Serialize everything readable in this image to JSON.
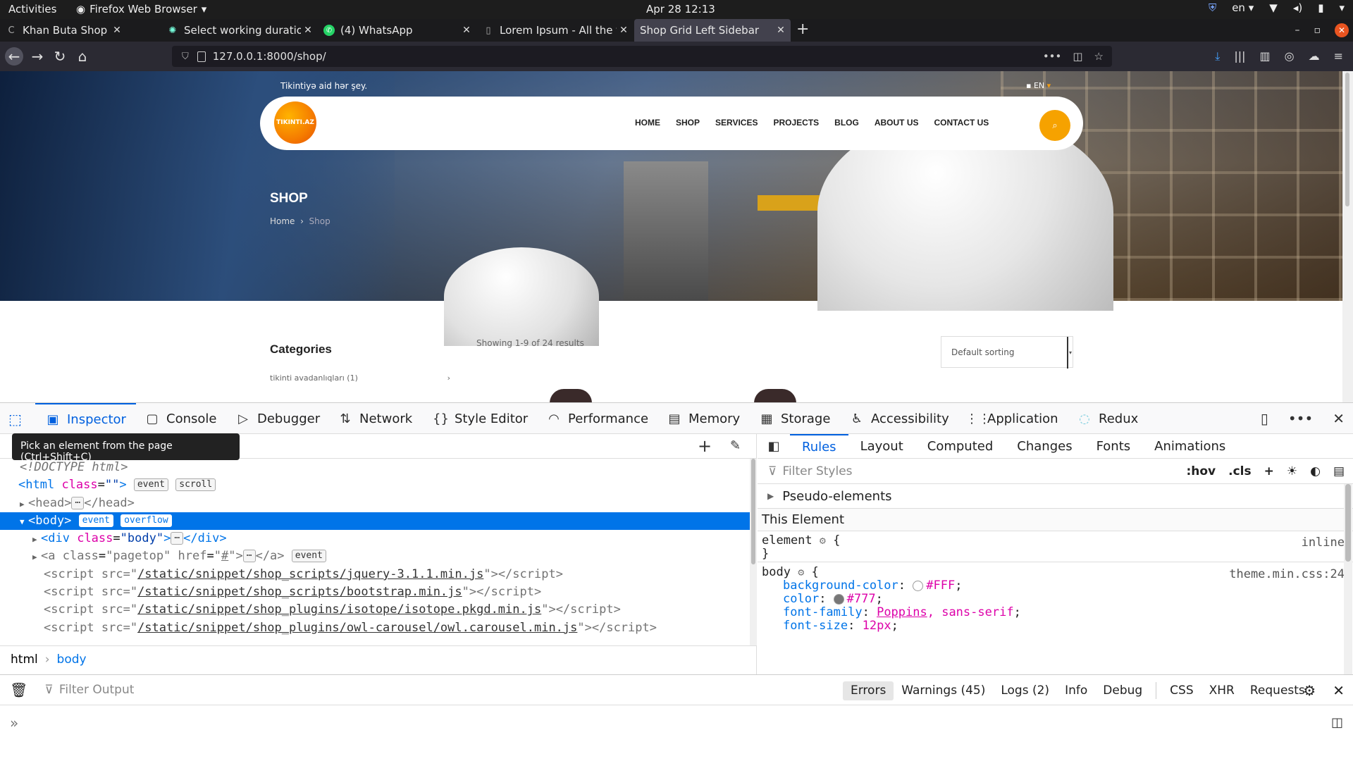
{
  "system_bar": {
    "activities": "Activities",
    "app_name": "Firefox Web Browser",
    "clock": "Apr 28  12:13",
    "lang": "en"
  },
  "tabs": [
    {
      "title": "Khan Buta Shop",
      "icon": "khan-buta-icon"
    },
    {
      "title": "Select working duration",
      "icon": "gear-icon"
    },
    {
      "title": "(4) WhatsApp",
      "icon": "whatsapp-icon"
    },
    {
      "title": "Lorem Ipsum - All the fac",
      "icon": "lorem-icon"
    },
    {
      "title": "Shop Grid Left Sidebar",
      "icon": "none",
      "active": true
    }
  ],
  "urlbar": {
    "url": "127.0.0.1:8000/shop/"
  },
  "site": {
    "tagline": "Tikintiyə aid hər şey.",
    "lang": "EN",
    "logo_text": "TIKINTI.AZ",
    "menu": [
      "HOME",
      "SHOP",
      "SERVICES",
      "PROJECTS",
      "BLOG",
      "ABOUT US",
      "CONTACT US"
    ],
    "page_title": "SHOP",
    "breadcrumb": {
      "home": "Home",
      "current": "Shop"
    },
    "categories_title": "Categories",
    "category_item": "tikinti avadanlıqları (1)",
    "results": "Showing 1-9 of 24 results",
    "sorting": "Default sorting"
  },
  "devtools": {
    "tooltip": "Pick an element from the page (Ctrl+Shift+C)",
    "tabs": [
      "Inspector",
      "Console",
      "Debugger",
      "Network",
      "Style Editor",
      "Performance",
      "Memory",
      "Storage",
      "Accessibility",
      "Application",
      "Redux"
    ],
    "markup": {
      "doctype": "<!DOCTYPE html>",
      "event": "event",
      "scroll": "scroll",
      "overflow": "overflow",
      "scripts": [
        "/static/snippet/shop_scripts/jquery-3.1.1.min.js",
        "/static/snippet/shop_scripts/bootstrap.min.js",
        "/static/snippet/shop_plugins/isotope/isotope.pkgd.min.js",
        "/static/snippet/shop_plugins/owl-carousel/owl.carousel.min.js"
      ]
    },
    "breadcrumbs": [
      "html",
      "body"
    ],
    "rules_tabs": [
      "Rules",
      "Layout",
      "Computed",
      "Changes",
      "Fonts",
      "Animations"
    ],
    "filter_styles": "Filter Styles",
    "hov": ":hov",
    "cls": ".cls",
    "pseudo_elements": "Pseudo-elements",
    "this_element": "This Element",
    "element_rule": {
      "selector": "element",
      "source": "inline"
    },
    "body_rule": {
      "selector": "body",
      "source": "theme.min.css:24",
      "decls": [
        {
          "prop": "background-color",
          "value": "#FFF",
          "swatch": "#FFFFFF"
        },
        {
          "prop": "color",
          "value": "#777",
          "swatch": "#777777"
        },
        {
          "prop": "font-family",
          "value": "Poppins",
          "value2": ", sans-serif"
        },
        {
          "prop": "font-size",
          "value": "12px"
        }
      ]
    },
    "console": {
      "filter": "Filter Output",
      "levels": [
        "Errors",
        "Warnings (45)",
        "Logs (2)",
        "Info",
        "Debug"
      ],
      "types": [
        "CSS",
        "XHR",
        "Requests"
      ]
    }
  }
}
